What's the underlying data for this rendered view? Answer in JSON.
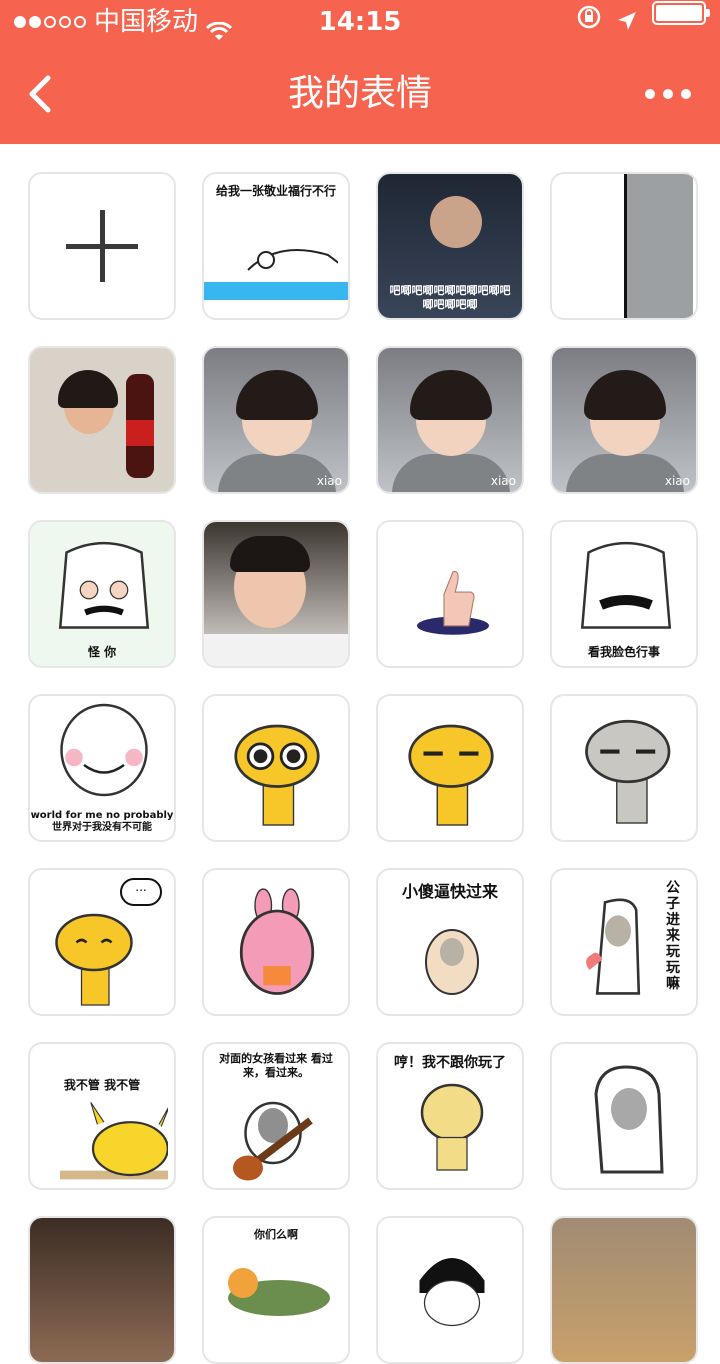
{
  "status_bar": {
    "carrier": "中国移动",
    "time": "14:15"
  },
  "nav": {
    "title": "我的表情"
  },
  "grid": {
    "add_icon": "plus-icon",
    "stickers": [
      {
        "caption": "给我一张敬业福行不行",
        "caption_pos": "top"
      },
      {
        "caption": "吧唧吧唧吧唧吧唧吧唧吧唧吧唧吧唧",
        "caption_pos": "bottom"
      },
      {
        "caption": "",
        "caption_pos": "none"
      },
      {
        "caption": "",
        "caption_pos": "none"
      },
      {
        "caption": "",
        "caption_pos": "none",
        "watermark": "xiao"
      },
      {
        "caption": "",
        "caption_pos": "none",
        "watermark": "xiao"
      },
      {
        "caption": "",
        "caption_pos": "none",
        "watermark": "xiao"
      },
      {
        "caption": "怪 你",
        "caption_pos": "bottom"
      },
      {
        "caption": "",
        "caption_pos": "none"
      },
      {
        "caption": "",
        "caption_pos": "none"
      },
      {
        "caption": "看我脸色行事",
        "caption_pos": "bottom"
      },
      {
        "caption": "world for me no probably 世界对于我没有不可能",
        "caption_pos": "bottom"
      },
      {
        "caption": "",
        "caption_pos": "none"
      },
      {
        "caption": "",
        "caption_pos": "none"
      },
      {
        "caption": "",
        "caption_pos": "none"
      },
      {
        "caption": "",
        "caption_pos": "none",
        "bubble": "..."
      },
      {
        "caption": "",
        "caption_pos": "none"
      },
      {
        "caption": "小傻逼快过来",
        "caption_pos": "top"
      },
      {
        "caption": "公子进来玩玩嘛",
        "caption_pos": "vertical"
      },
      {
        "caption": "我不管 我不管",
        "caption_pos": "top"
      },
      {
        "caption": "对面的女孩看过来 看过来，看过来。",
        "caption_pos": "top"
      },
      {
        "caption": "哼！我不跟你玩了",
        "caption_pos": "top"
      },
      {
        "caption": "",
        "caption_pos": "none"
      },
      {
        "caption": "",
        "caption_pos": "none"
      },
      {
        "caption": "你们么啊",
        "caption_pos": "top"
      },
      {
        "caption": "",
        "caption_pos": "none"
      },
      {
        "caption": "",
        "caption_pos": "none"
      }
    ]
  }
}
